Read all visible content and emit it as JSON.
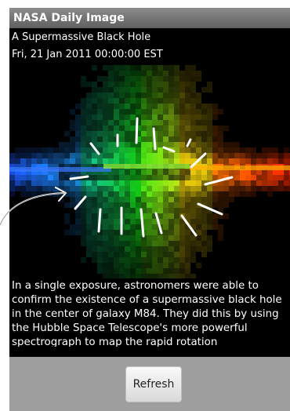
{
  "app": {
    "title": "NASA Daily Image"
  },
  "item": {
    "title": "A Supermassive Black Hole",
    "date": "Fri, 21 Jan 2011 00:00:00 EST",
    "description": "In a single exposure, astronomers were able to confirm the existence of a supermassive black hole in the center of galaxy M84. They did this by using the Hubble Space Telescope's more powerful spectrograph to map the rapid rotation"
  },
  "footer": {
    "refresh_label": "Refresh"
  },
  "colors": {
    "title_bar": "#6f6f6f",
    "background": "#000000",
    "footer": "#9e9e9e"
  }
}
